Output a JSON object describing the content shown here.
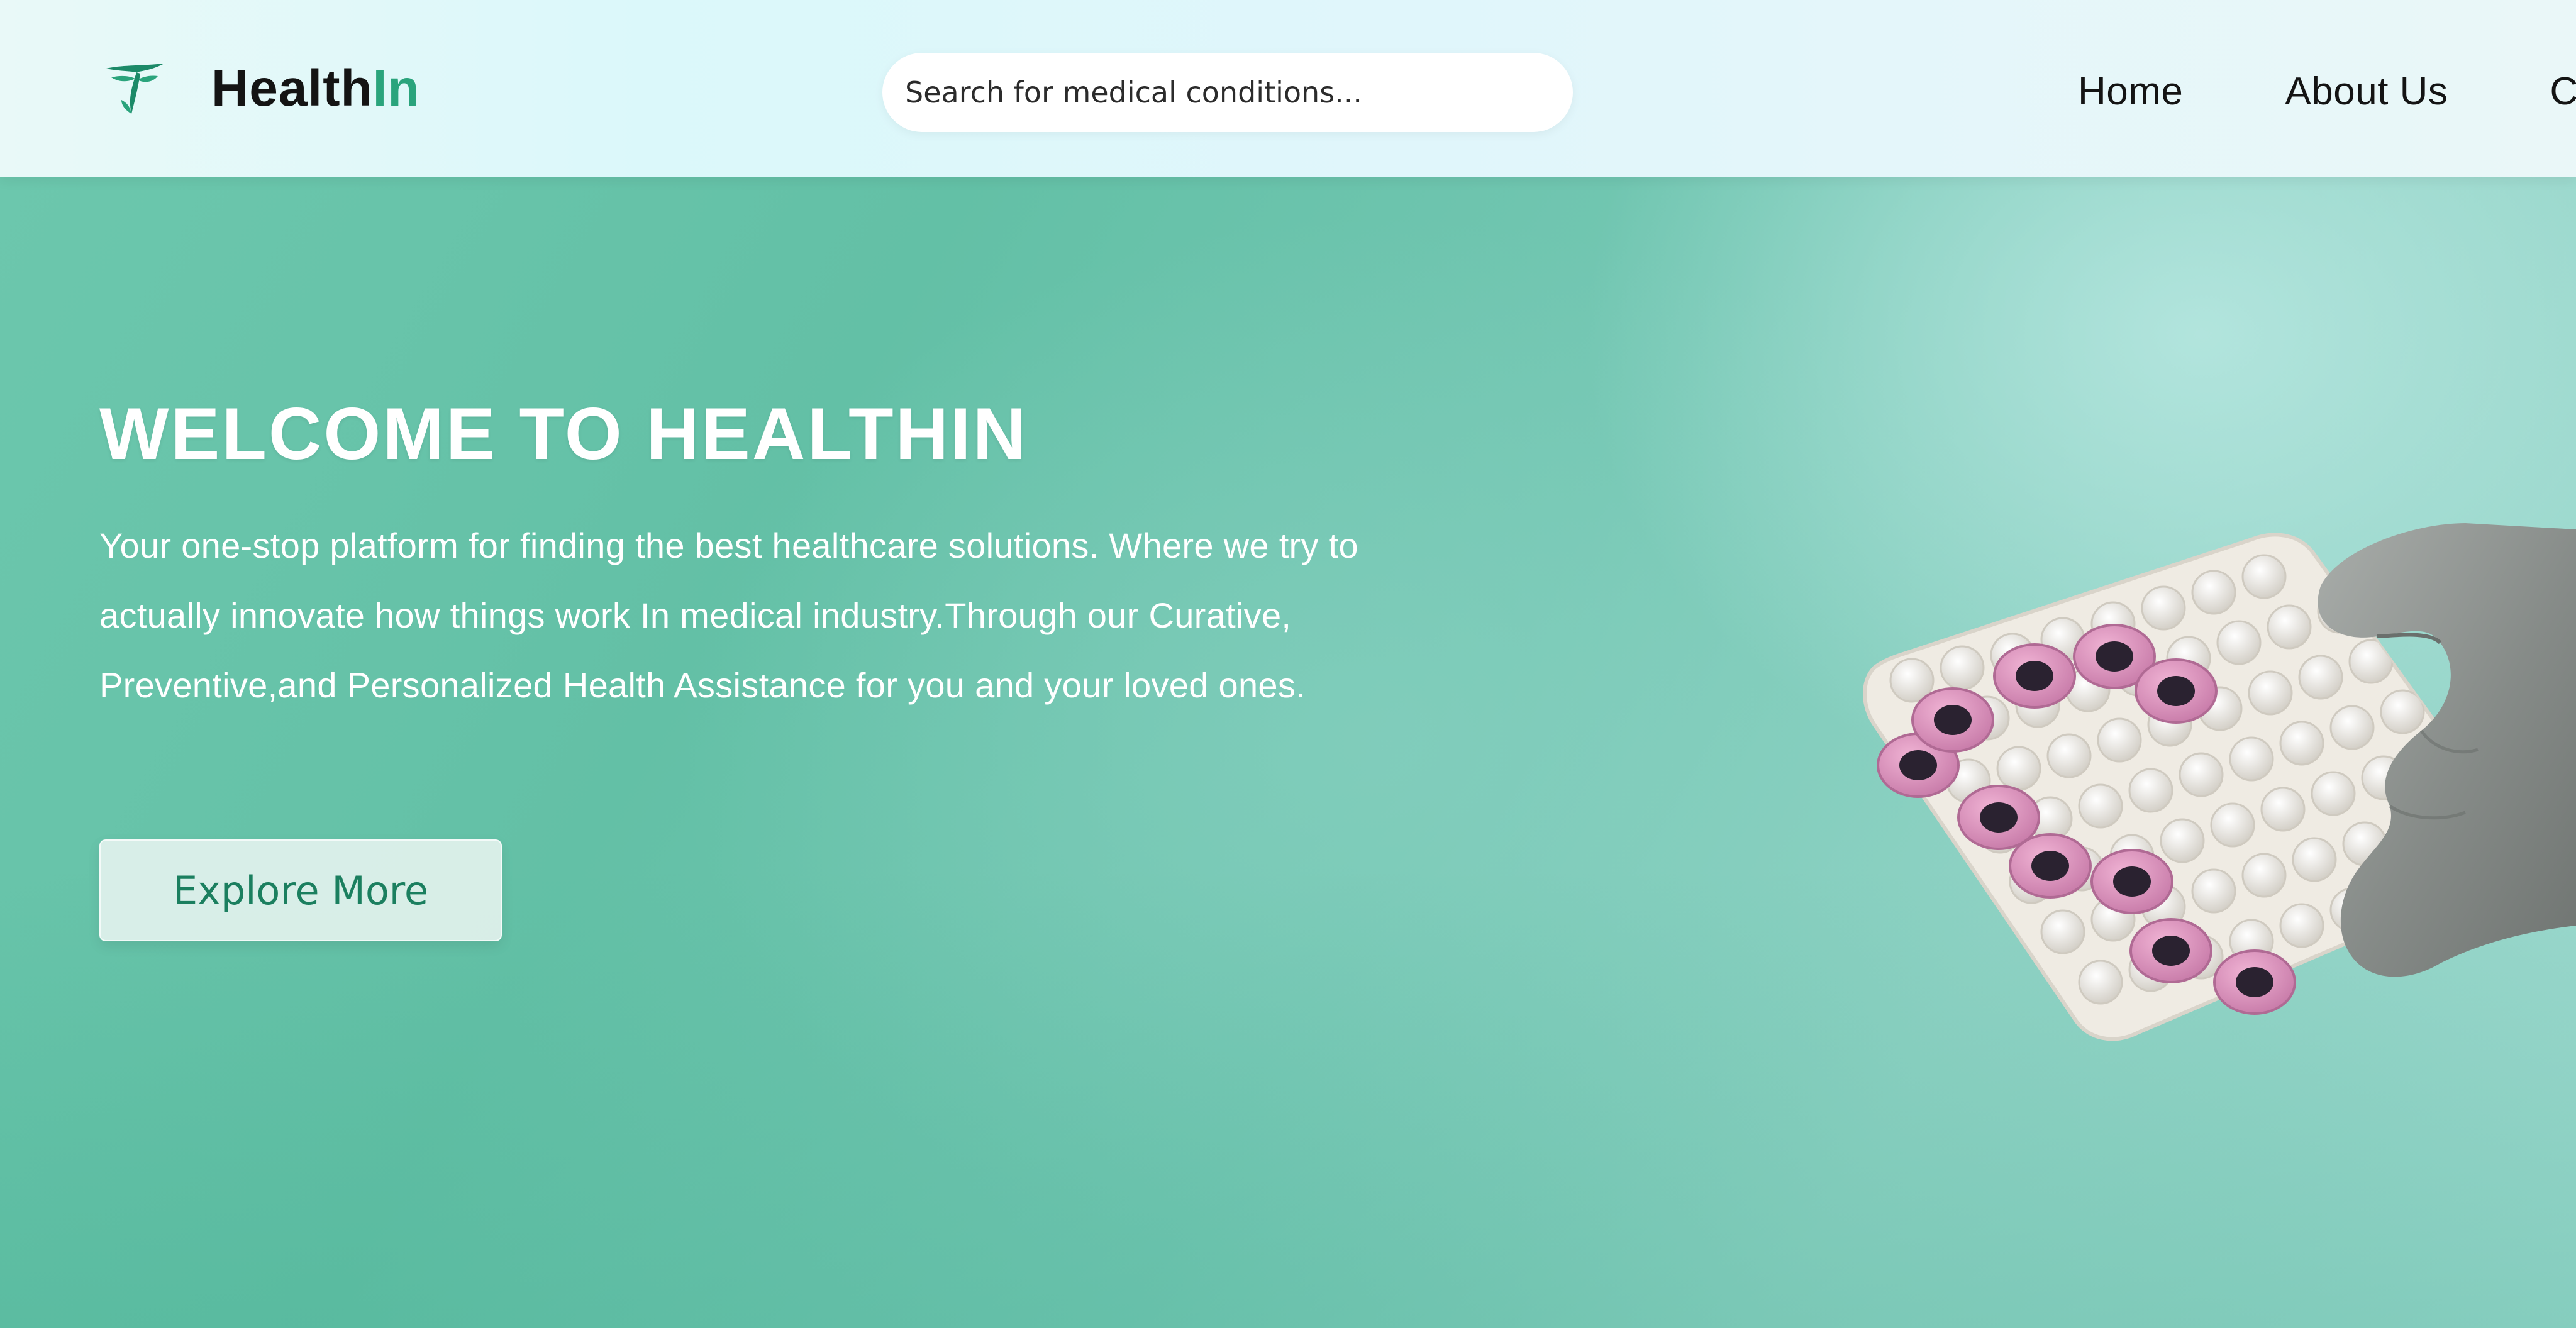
{
  "brand": {
    "name_main": "Health",
    "name_accent": "In",
    "logo_icon": "leaf-logo-icon",
    "accent_color": "#2aa47c"
  },
  "search": {
    "placeholder": "Search for medical conditions...",
    "value": ""
  },
  "nav": {
    "items": [
      {
        "label": "Home"
      },
      {
        "label": "About Us"
      },
      {
        "label": "C"
      }
    ]
  },
  "hero": {
    "title": "WELCOME TO HEALTHIN",
    "description": "Your one-stop platform for finding the best healthcare solutions. Where we try to actually innovate how things work In medical industry.Through our Curative, Preventive,and Personalized Health Assistance for you and your loved ones.",
    "cta_label": "Explore More",
    "image_icon": "gloved-hand-holding-vial-tray-image",
    "background_color": "#5fbfa3",
    "cta_text_color": "#1b7f5f"
  }
}
